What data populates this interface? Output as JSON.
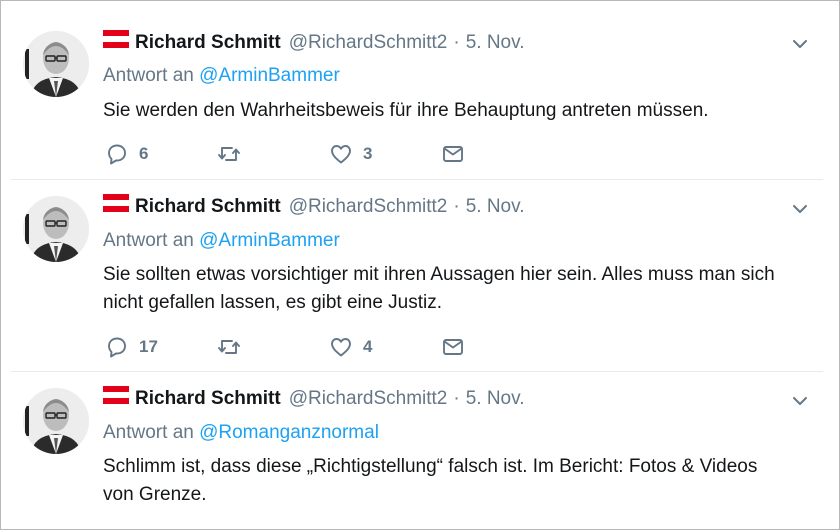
{
  "tweets": [
    {
      "name": "Richard Schmitt",
      "handle": "@RichardSchmitt2",
      "separator": "·",
      "date": "5. Nov.",
      "reply_prefix": "Antwort an",
      "reply_to": "@ArminBammer",
      "text": "Sie werden den Wahrheitsbeweis für ihre Behauptung antreten müssen.",
      "replies": "6",
      "retweets": "",
      "likes": "3"
    },
    {
      "name": "Richard Schmitt",
      "handle": "@RichardSchmitt2",
      "separator": "·",
      "date": "5. Nov.",
      "reply_prefix": "Antwort an",
      "reply_to": "@ArminBammer",
      "text": "Sie sollten etwas vorsichtiger mit ihren Aussagen hier sein. Alles muss man sich nicht gefallen lassen, es gibt eine Justiz.",
      "replies": "17",
      "retweets": "",
      "likes": "4"
    },
    {
      "name": "Richard Schmitt",
      "handle": "@RichardSchmitt2",
      "separator": "·",
      "date": "5. Nov.",
      "reply_prefix": "Antwort an",
      "reply_to": "@Romanganznormal",
      "text": "Schlimm ist, dass diese „Richtigstellung“ falsch ist. Im Bericht: Fotos & Videos von Grenze."
    }
  ],
  "icons": {
    "flag": "austria-flag-icon",
    "more": "chevron-down-icon",
    "reply": "reply-icon",
    "retweet": "retweet-icon",
    "like": "heart-icon",
    "dm": "envelope-icon"
  },
  "colors": {
    "text": "#14171a",
    "secondary": "#657786",
    "link": "#1da1f2",
    "flag_red": "#e3001b",
    "divider": "#e6ecf0"
  }
}
